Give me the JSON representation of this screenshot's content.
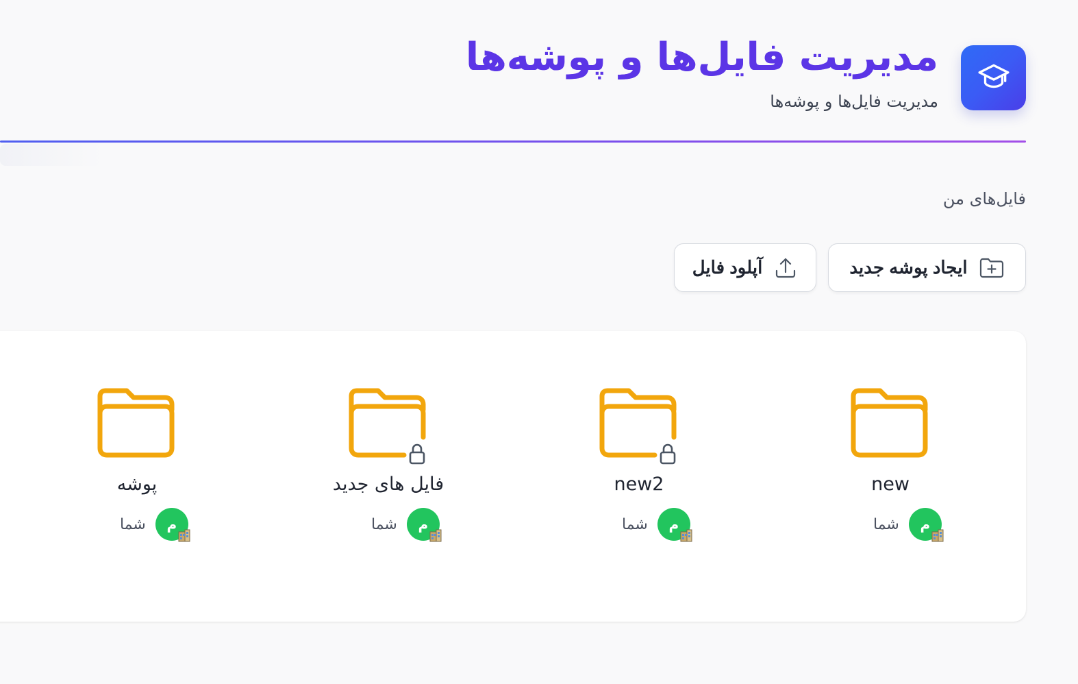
{
  "header": {
    "title": "مدیریت فایل‌ها و پوشه‌ها",
    "subtitle": "مدیریت فایل‌ها و پوشه‌ها",
    "logo_icon": "graduation-cap-icon",
    "accent_color": "#4f5ef0",
    "title_color": "#6a3ee8"
  },
  "section": {
    "label": "فایل‌های من"
  },
  "toolbar": {
    "new_folder_label": "ایجاد پوشه جدید",
    "new_folder_icon": "folder-plus-icon",
    "upload_label": "آپلود فایل",
    "upload_icon": "upload-icon"
  },
  "items": [
    {
      "name": "new",
      "type": "folder",
      "locked": false,
      "owner": "شما",
      "avatar": "م"
    },
    {
      "name": "new2",
      "type": "folder",
      "locked": true,
      "owner": "شما",
      "avatar": "م"
    },
    {
      "name": "فایل های جدید",
      "type": "folder",
      "locked": true,
      "owner": "شما",
      "avatar": "م"
    },
    {
      "name": "پوشه",
      "type": "folder",
      "locked": false,
      "owner": "شما",
      "avatar": "م"
    }
  ],
  "colors": {
    "folder": "#f2a60c",
    "avatar": "#22c55e"
  }
}
